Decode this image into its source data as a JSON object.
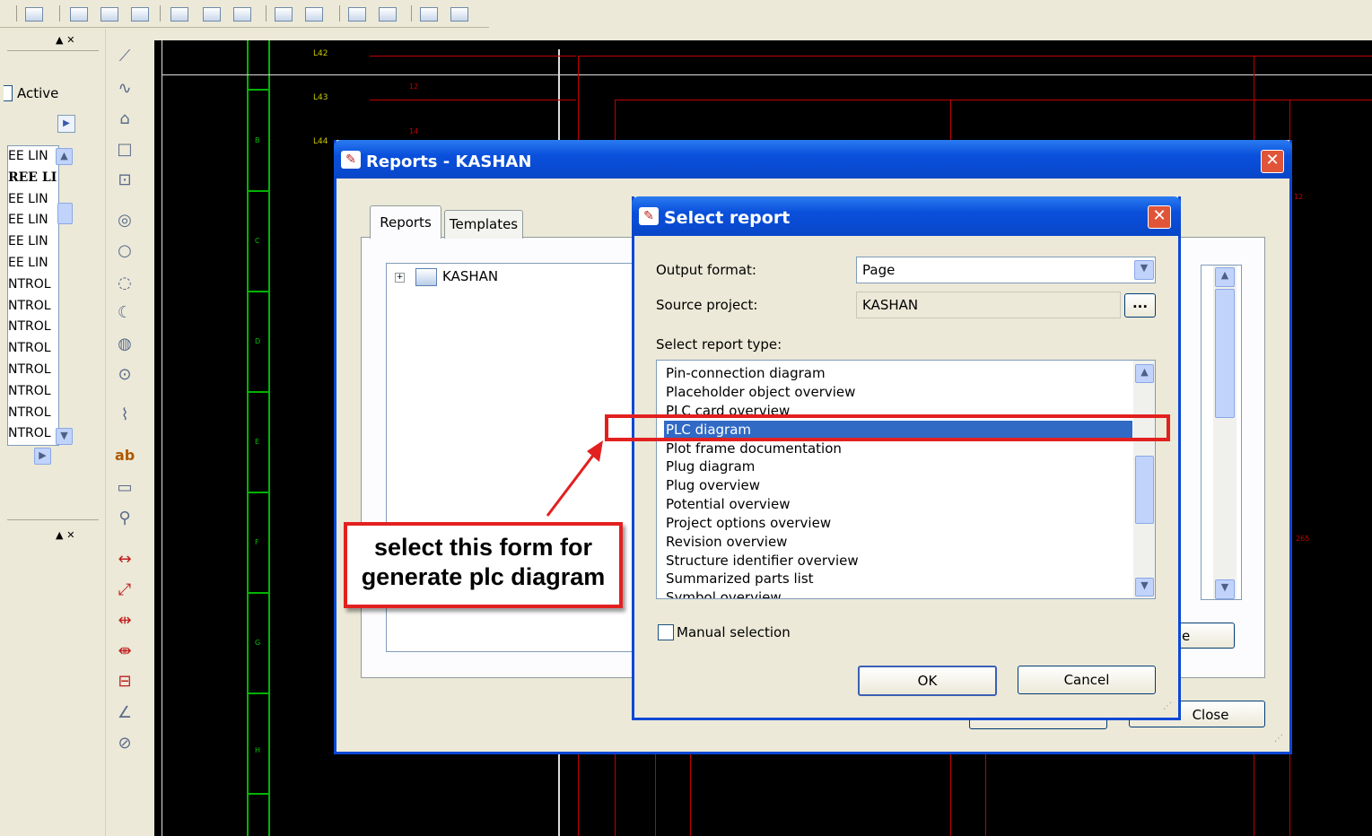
{
  "left_panel": {
    "active_label": "Active",
    "list_items": [
      "EE LIN",
      "REE LI",
      "EE LIN",
      "EE LIN",
      "EE LIN",
      "EE LIN",
      "NTROL",
      "NTROL",
      "NTROL",
      "NTROL",
      "NTROL",
      "NTROL",
      "NTROL",
      "NTROL"
    ],
    "dock_glyph_1": "▲ ✕",
    "dock_glyph_2": "▲ ✕"
  },
  "schematic": {
    "line_labels": [
      "L42",
      "L43",
      "L44"
    ],
    "row_letters": [
      "B",
      "C",
      "D",
      "E",
      "F",
      "G",
      "H"
    ],
    "small_numbers": [
      "12",
      "14",
      "12",
      "265"
    ]
  },
  "reports_dialog": {
    "title": "Reports - KASHAN",
    "tabs": [
      "Reports",
      "Templates"
    ],
    "tree_root": "KASHAN",
    "close_button": "Close",
    "partial_button": "e"
  },
  "select_report_dialog": {
    "title": "Select report",
    "output_format_label": "Output format:",
    "output_format_value": "Page",
    "source_project_label": "Source project:",
    "source_project_value": "KASHAN",
    "browse_label": "...",
    "report_type_label": "Select report type:",
    "report_types": [
      "Pin-connection diagram",
      "Placeholder object overview",
      "PLC card overview",
      "PLC diagram",
      "Plot frame documentation",
      "Plug diagram",
      "Plug overview",
      "Potential overview",
      "Project options overview",
      "Revision overview",
      "Structure identifier overview",
      "Summarized parts list",
      "Symbol overview"
    ],
    "selected_report_type": "PLC diagram",
    "manual_selection_label": "Manual selection",
    "ok_label": "OK",
    "cancel_label": "Cancel"
  },
  "annotation": {
    "callout_line1": "select this form for",
    "callout_line2": "generate plc diagram",
    "color": "#e32020"
  },
  "colors": {
    "titlebar": "#0a50dc",
    "selection": "#316ac5",
    "schematic_bg": "#000000",
    "green_line": "#00b300",
    "red_line": "#c20000"
  }
}
